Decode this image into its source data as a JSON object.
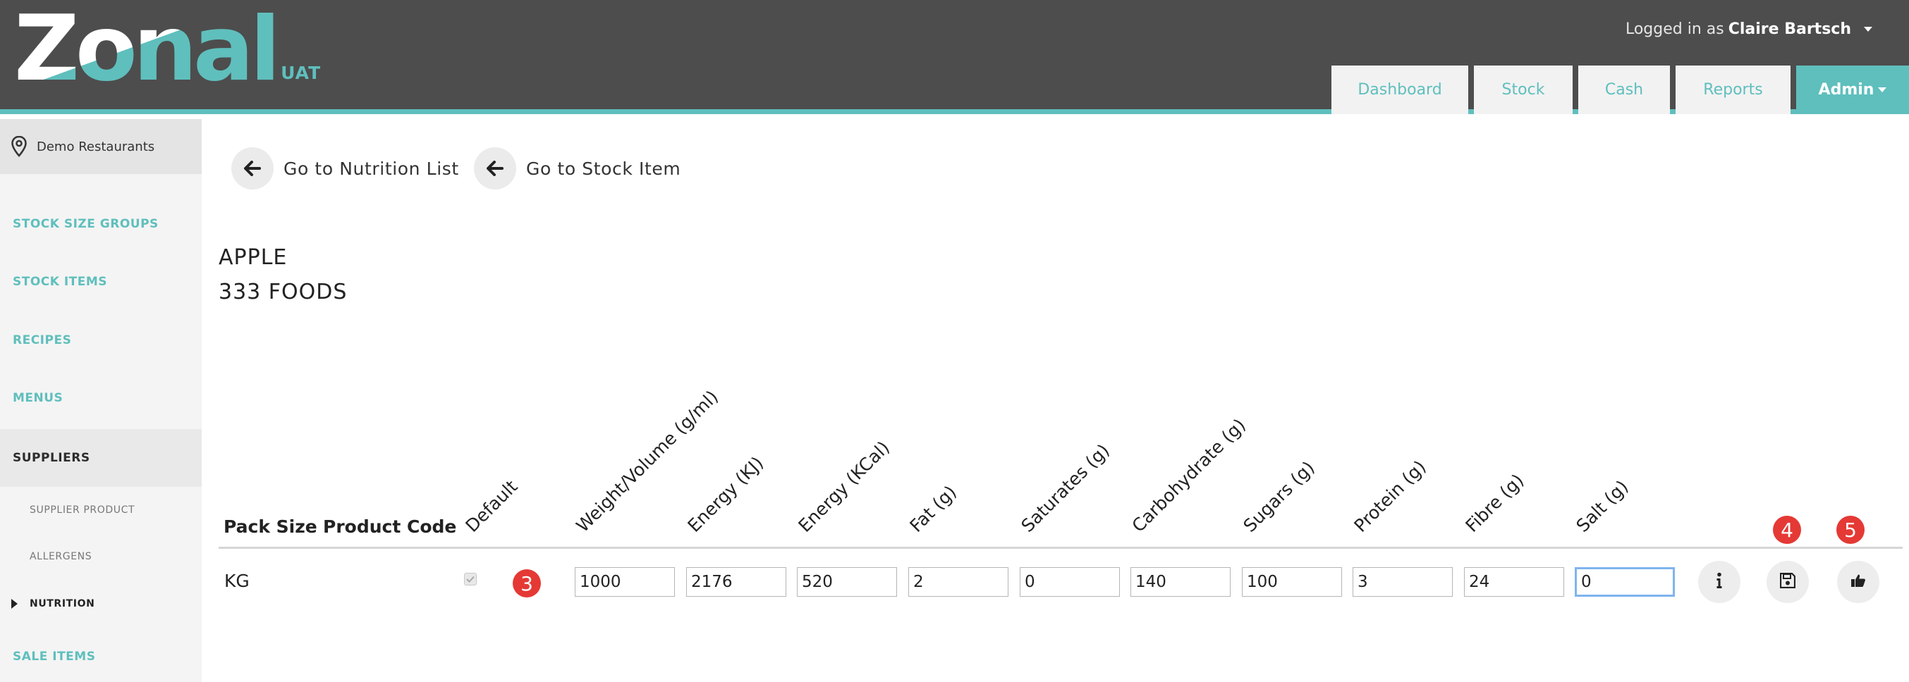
{
  "header": {
    "logo_text": "Zonal",
    "logo_sub": "UAT",
    "user_prefix": "Logged in as",
    "user_name": "Claire Bartsch",
    "nav": [
      "Dashboard",
      "Stock",
      "Cash",
      "Reports",
      "Admin"
    ]
  },
  "sidebar": {
    "site": "Demo Restaurants",
    "items": [
      "STOCK SIZE GROUPS",
      "STOCK ITEMS",
      "RECIPES",
      "MENUS",
      "SUPPLIERS",
      "SALE ITEMS"
    ],
    "sub_items": [
      "SUPPLIER PRODUCT",
      "ALLERGENS",
      "NUTRITION"
    ]
  },
  "links": {
    "nutrition_list": "Go to Nutrition List",
    "stock_item": "Go to Stock Item"
  },
  "item": {
    "title": "APPLE",
    "supplier": "333 FOODS"
  },
  "table": {
    "headers": {
      "pack_size": "Pack Size",
      "product_code": "Product Code",
      "default": "Default",
      "weight": "Weight/Volume (g/ml)",
      "energy_kj": "Energy (KJ)",
      "energy_kcal": "Energy (KCal)",
      "fat": "Fat (g)",
      "saturates": "Saturates (g)",
      "carbohydrate": "Carbohydrate (g)",
      "sugars": "Sugars (g)",
      "protein": "Protein (g)",
      "fibre": "Fibre (g)",
      "salt": "Salt (g)"
    },
    "row": {
      "pack_size": "KG",
      "default_checked": true,
      "weight": "1000",
      "energy_kj": "2176",
      "energy_kcal": "520",
      "fat": "2",
      "saturates": "0",
      "carbohydrate": "140",
      "sugars": "100",
      "protein": "3",
      "fibre": "24",
      "salt": "0"
    }
  },
  "badges": {
    "b3": "3",
    "b4": "4",
    "b5": "5"
  },
  "icons": {
    "location": "location-pin-icon",
    "back": "arrow-left-icon",
    "info": "info-icon",
    "save": "floppy-disk-icon",
    "approve": "thumbs-up-icon"
  },
  "colors": {
    "header_bg": "#4d4d4d",
    "accent": "#5fbfbd",
    "badge": "#e53935",
    "focus": "#7fb4ee"
  }
}
